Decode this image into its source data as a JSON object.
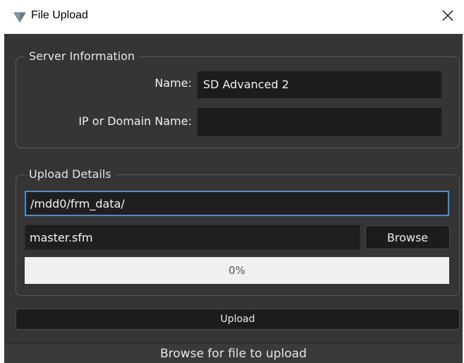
{
  "window": {
    "title": "File Upload",
    "icon": "triangle-down-icon",
    "close_glyph": "✕"
  },
  "server": {
    "group_title": "Server Information",
    "name_label": "Name:",
    "name_value": "SD Advanced 2",
    "ip_label": "IP or Domain Name:",
    "ip_value": ""
  },
  "upload": {
    "group_title": "Upload Details",
    "path_value": "/mdd0/frm_data/",
    "file_value": "master.sfm",
    "browse_label": "Browse",
    "progress": 0,
    "progress_text": "0%",
    "upload_label": "Upload"
  },
  "status": {
    "text": "Browse for file to upload"
  },
  "colors": {
    "accent": "#3d8ee6",
    "background": "#353535",
    "field": "#1c1c1c"
  }
}
